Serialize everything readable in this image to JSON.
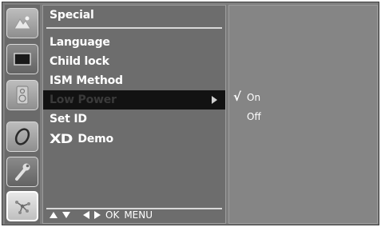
{
  "menu": {
    "title": "Special",
    "items": [
      {
        "label": "Language"
      },
      {
        "label": "Child lock"
      },
      {
        "label": "ISM Method"
      },
      {
        "label": "Low Power",
        "selected": true
      },
      {
        "label": "Set ID"
      },
      {
        "label": "Demo",
        "logo": "XD"
      }
    ]
  },
  "navigation": {
    "ok": "OK",
    "menu": "MENU"
  },
  "options": {
    "items": [
      {
        "label": "On",
        "checked": true
      },
      {
        "label": "Off",
        "checked": false
      }
    ],
    "check_mark": "√"
  },
  "sidebar": {
    "icons": [
      "picture-icon",
      "screen-icon",
      "speaker-icon",
      "clock-icon",
      "wrench-icon",
      "network-icon"
    ]
  }
}
